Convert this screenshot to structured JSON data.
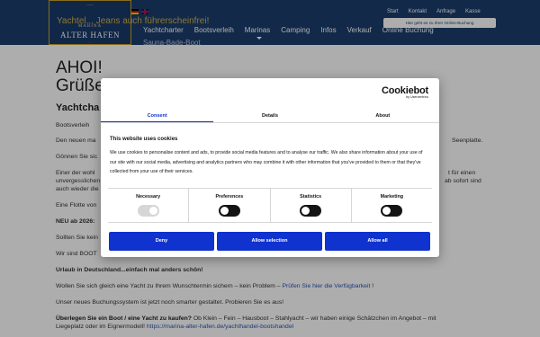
{
  "header": {
    "logo": {
      "top_text": "......",
      "marina": "MARINA",
      "name": "ALTER HAFEN",
      "bottom_text": "......"
    },
    "slogan": "Yachtel... Jeans auch führerscheinfrei!",
    "flags": [
      "de-flag-icon",
      "en-flag-icon"
    ],
    "top_links": [
      "Start",
      "Kontakt",
      "Anfrage",
      "Kasse"
    ],
    "booking_button": "Hier geht es zu Ihrer Online-Buchung",
    "nav": [
      "Yachtcharter",
      "Bootsverleih",
      "Marinas",
      "Camping",
      "Infos",
      "Verkauf",
      "Online Buchung"
    ],
    "nav_active": "Marinas",
    "nav_second_row": "Sauna-Bade-Boot"
  },
  "content": {
    "greet1": "AHOI!",
    "greet2": "Grüße",
    "subhead": "Yachtcha",
    "p1": "Bootsverleih",
    "p2a": "Den neuen ma",
    "p2b": "Seenplatte.",
    "p3": "Gönnen Sie sic",
    "p4a": "Einer der wohl",
    "p4b": "unvergesslichen",
    "p4c": "auch wieder die",
    "p4d": "t für einen",
    "p4e": "ab sofort sind",
    "p5": "Eine Flotte von",
    "p6": "NEU ab 2026:",
    "p7": "Sollten Sie kein",
    "p8": "Wir sind BOOT",
    "p9": "Urlaub in Deutschland...einfach mal anders schön!",
    "p10_text": "Wollen Sie sich gleich eine Yacht zu Ihrem Wunschtermin sichern – kein Problem –",
    "p10_link": "Prüfen Sie hier die Verfügbarkeit",
    "p10_end": "!",
    "p11": "Unser neues Buchungssystem ist jetzt noch smarter gestaltet. Probieren Sie es aus!",
    "p12_bold": "Überlegen Sie ein Boot / eine Yacht zu kaufen?",
    "p12_text": "Ob Klein – Fein – Hausboot – Stahlyacht – wir haben einige Schätzchen im Angebot – mit",
    "p12_text2": "Liegeplatz oder im Eignermodell!",
    "p12_link": "https://marina-alter-hafen.de/yachthandel-bootshandel"
  },
  "cookie_dialog": {
    "logo": "Cookiebot",
    "logo_sub": "by Usercentrics",
    "tabs": [
      "Consent",
      "Details",
      "About"
    ],
    "active_tab": "Consent",
    "title": "This website uses cookies",
    "text": "We use cookies to personalise content and ads, to provide social media features and to analyse our traffic. We also share information about your use of our site with our social media, advertising and analytics partners who may combine it with other information that you've provided to them or that they've collected from your use of their services.",
    "categories": [
      {
        "label": "Necessary",
        "state": "on-disabled"
      },
      {
        "label": "Preferences",
        "state": "off"
      },
      {
        "label": "Statistics",
        "state": "off"
      },
      {
        "label": "Marketing",
        "state": "off"
      }
    ],
    "buttons": [
      "Deny",
      "Allow selection",
      "Allow all"
    ]
  },
  "colors": {
    "header_bg": "#1b3d6e",
    "accent": "#1032cf",
    "slogan": "#f3c43d"
  }
}
